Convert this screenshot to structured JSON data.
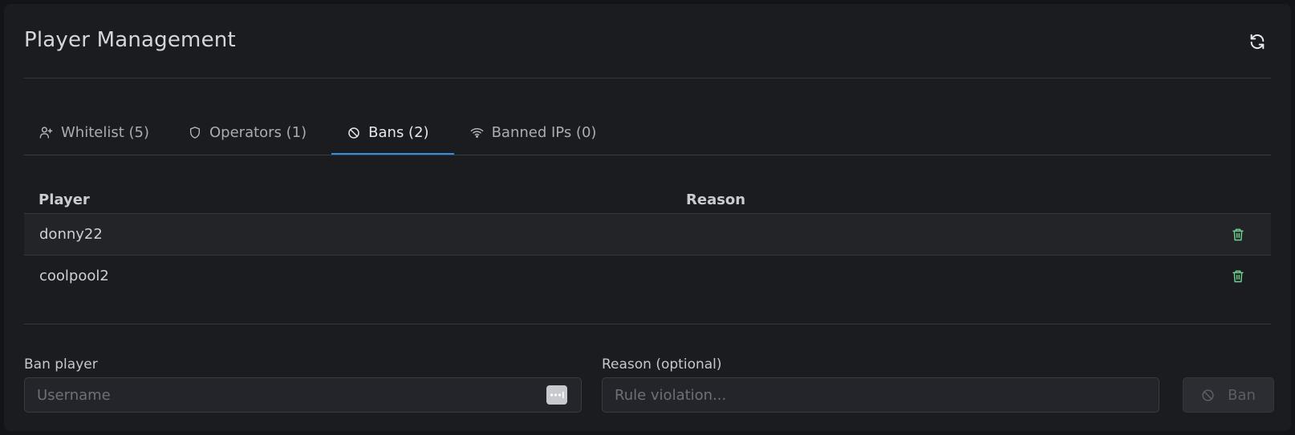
{
  "header": {
    "title": "Player Management",
    "refresh_icon": "refresh-icon"
  },
  "tabs": [
    {
      "label": "Whitelist (5)",
      "icon": "user-plus-icon",
      "active": false
    },
    {
      "label": "Operators (1)",
      "icon": "shield-icon",
      "active": false
    },
    {
      "label": "Bans (2)",
      "icon": "ban-icon",
      "active": true
    },
    {
      "label": "Banned IPs (0)",
      "icon": "wifi-icon",
      "active": false
    }
  ],
  "table": {
    "columns": [
      "Player",
      "Reason"
    ],
    "rows": [
      {
        "player": "donny22",
        "reason": ""
      },
      {
        "player": "coolpool2",
        "reason": ""
      }
    ]
  },
  "form": {
    "ban_label": "Ban player",
    "username_placeholder": "Username",
    "username_value": "",
    "reason_label": "Reason (optional)",
    "reason_placeholder": "Rule violation...",
    "reason_value": "",
    "ban_button_label": "Ban"
  },
  "colors": {
    "accent": "#2e8fe6",
    "delete": "#6fcf8f",
    "background": "#1b1c20"
  }
}
